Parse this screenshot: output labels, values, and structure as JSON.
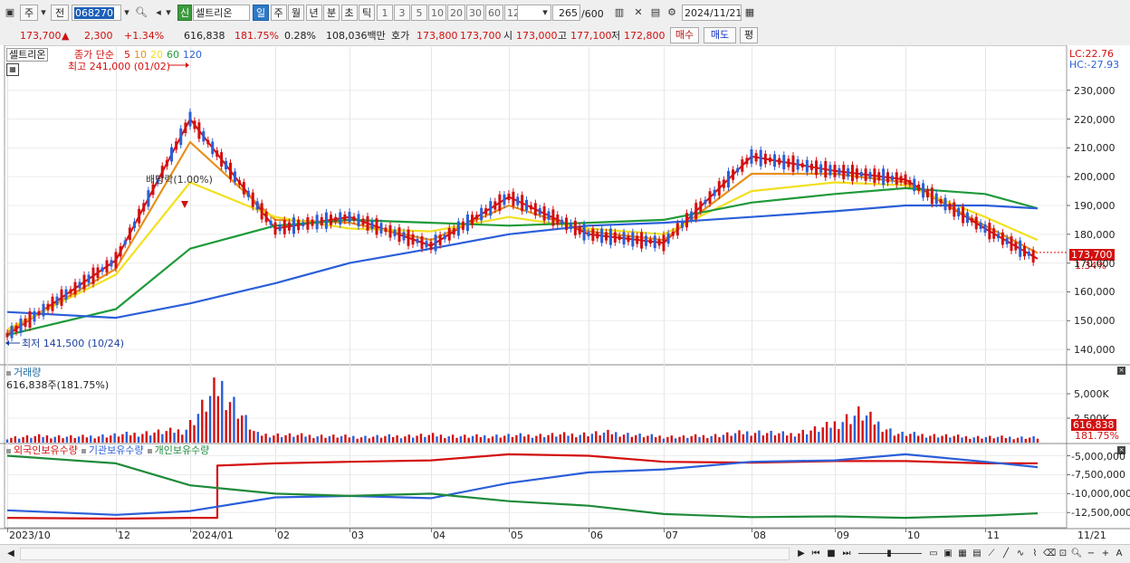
{
  "toolbar": {
    "type_label": "주",
    "prev_label": "전",
    "code": "068270",
    "name_badge": "신",
    "stock_name": "셀트리온",
    "periods": [
      "일",
      "주",
      "월",
      "년",
      "분",
      "초",
      "틱"
    ],
    "active_period": "일",
    "intervals": [
      "1",
      "3",
      "5",
      "10",
      "20",
      "30",
      "60",
      "120"
    ],
    "count": "265",
    "count_total": "/600",
    "date": "2024/11/21"
  },
  "quote": {
    "price": "173,700",
    "change_arrow": "▲",
    "change": "2,300",
    "change_pct": "+1.34%",
    "volume": "616,838",
    "volume_ratio": "181.75%",
    "turnover": "0.28%",
    "amount": "108,036백만",
    "quote_label": "호가",
    "ask": "173,800",
    "bid": "173,700",
    "open_label": "시",
    "open": "173,000",
    "high_label": "고",
    "high": "177,100",
    "low_label": "저",
    "low": "172,800",
    "buy_label": "매수",
    "sell_label": "매도",
    "avg_label": "평"
  },
  "price_panel": {
    "tag": "셀트리온",
    "ma_title": "종가 단순",
    "ma_periods": [
      "5",
      "10",
      "20",
      "60",
      "120"
    ],
    "ma_colors": [
      "#d41010",
      "#e8901a",
      "#f2e020",
      "#1e9a3a",
      "#2b5fd9"
    ],
    "high_note": "최고 241,000 (01/02)",
    "low_note": "최저 141,500 (10/24)",
    "dividend_note": "배당락(1.00%)",
    "lc": "LC:22.76",
    "hc": "HC:-27.93",
    "current_price": "173,700",
    "current_pct": "1.34%",
    "y_ticks": [
      "230,000",
      "220,000",
      "210,000",
      "200,000",
      "190,000",
      "180,000",
      "170,000",
      "160,000",
      "150,000",
      "140,000"
    ]
  },
  "volume_panel": {
    "title": "거래량",
    "value": "616,838주(181.75%)",
    "y_ticks": [
      "5,000K",
      "2,500K"
    ],
    "current": "616,838",
    "current_pct": "181.75%"
  },
  "holding_panel": {
    "legend": [
      "외국인보유수량",
      "기관보유수량",
      "개인보유수량"
    ],
    "colors": [
      "#d41010",
      "#2b5fd9",
      "#1e8a3a"
    ],
    "y_ticks": [
      "-5,000,000",
      "-7,500,000",
      "-10,000,000",
      "-12,500,000"
    ]
  },
  "x_axis": [
    "2023/10",
    "12",
    "2024/01",
    "02",
    "03",
    "04",
    "05",
    "06",
    "07",
    "08",
    "09",
    "10",
    "11",
    "11/21"
  ],
  "chart_data": [
    {
      "type": "line",
      "title": "셀트리온",
      "x": [
        "2023/10",
        "12",
        "2024/01",
        "02",
        "03",
        "04",
        "05",
        "06",
        "07",
        "08",
        "09",
        "10",
        "11",
        "11/21"
      ],
      "ylim": [
        135000,
        245000
      ],
      "series": [
        {
          "name": "종가 단순 5",
          "values": [
            145000,
            171000,
            220000,
            182000,
            186000,
            176000,
            193000,
            180000,
            177000,
            207000,
            202000,
            199000,
            182000,
            171500
          ]
        },
        {
          "name": "10",
          "values": [
            146000,
            168000,
            212000,
            185000,
            184000,
            178000,
            190000,
            181000,
            178000,
            201000,
            201000,
            198000,
            183000,
            173500
          ]
        },
        {
          "name": "20",
          "values": [
            147000,
            166000,
            198000,
            186000,
            182000,
            181000,
            186000,
            182000,
            180000,
            195000,
            198000,
            197000,
            186000,
            178000
          ]
        },
        {
          "name": "60",
          "values": [
            145000,
            154000,
            175000,
            183000,
            185000,
            184000,
            183000,
            184000,
            185000,
            191000,
            194000,
            196000,
            194000,
            189000
          ]
        },
        {
          "name": "120",
          "values": [
            153000,
            151000,
            156000,
            163000,
            170000,
            175000,
            180000,
            183000,
            184000,
            186000,
            188000,
            190000,
            190000,
            189000
          ]
        }
      ]
    },
    {
      "type": "bar",
      "title": "거래량",
      "ylim": [
        0,
        7500000
      ],
      "values": [
        600000,
        800000,
        700000,
        900000,
        1200000,
        1500000,
        7000000,
        1000000,
        900000,
        800000,
        700000,
        800000,
        900000,
        750000,
        850000,
        900000,
        1000000,
        1200000,
        800000,
        700000,
        900000,
        1300000,
        1000000,
        1800000,
        3600000,
        1100000,
        900000,
        700000,
        650000,
        616838
      ]
    },
    {
      "type": "line",
      "title": "보유수량",
      "ylim": [
        -14500000,
        -3500000
      ],
      "series": [
        {
          "name": "외국인보유수량",
          "values": [
            -13200000,
            -13300000,
            -13200000,
            -6000000,
            -5800000,
            -5600000,
            -4800000,
            -5000000,
            -5800000,
            -5900000,
            -5700000,
            -5700000,
            -6000000,
            -6000000
          ]
        },
        {
          "name": "기관보유수량",
          "values": [
            -12200000,
            -12800000,
            -12300000,
            -10500000,
            -10300000,
            -10600000,
            -8600000,
            -7200000,
            -6800000,
            -5800000,
            -5600000,
            -4800000,
            -5800000,
            -6500000
          ]
        },
        {
          "name": "개인보유수량",
          "values": [
            -5000000,
            -6000000,
            -8900000,
            -10000000,
            -10300000,
            -10000000,
            -11000000,
            -11600000,
            -12700000,
            -13100000,
            -13000000,
            -13200000,
            -12900000,
            -12600000
          ]
        }
      ]
    }
  ]
}
